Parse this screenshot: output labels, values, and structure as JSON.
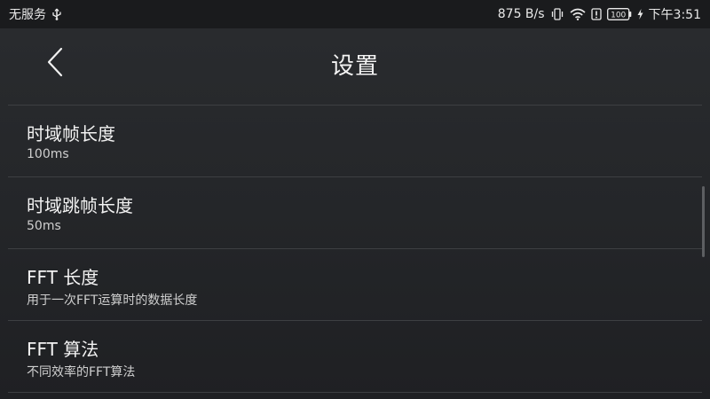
{
  "status_bar": {
    "carrier": "无服务",
    "network_speed": "875 B/s",
    "battery_level": "100",
    "time": "下午3:51",
    "icons": [
      "usb-icon",
      "vibrate-icon",
      "wifi-icon",
      "alert-icon",
      "battery-icon",
      "charge-icon"
    ]
  },
  "header": {
    "title": "设置"
  },
  "settings": [
    {
      "title": "时域帧长度",
      "subtitle": "100ms"
    },
    {
      "title": "时域跳帧长度",
      "subtitle": "50ms"
    },
    {
      "title": "FFT 长度",
      "subtitle": "用于一次FFT运算时的数据长度"
    },
    {
      "title": "FFT 算法",
      "subtitle": "不同效率的FFT算法"
    }
  ],
  "colors": {
    "background_top": "#2a2c2f",
    "background_bottom": "#1f2023",
    "status_bar": "#1a1b1d",
    "divider": "#3d3f42",
    "text_primary": "#f2f2f2",
    "text_secondary": "#cfcfcf"
  }
}
